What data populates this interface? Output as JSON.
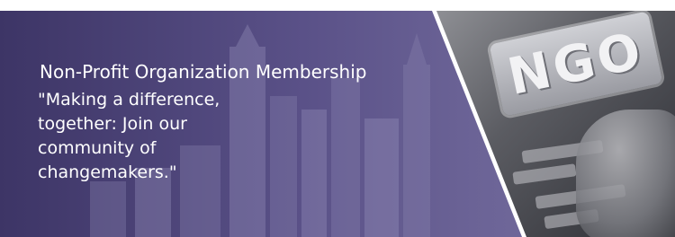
{
  "banner": {
    "title": "Non-Profit Organization Membership",
    "quote_lines": [
      "\"Making a difference,",
      "together: Join our",
      "community of",
      "changemakers.\""
    ],
    "key_text": "NGO"
  },
  "colors": {
    "purple_dark": "#3d3566",
    "purple_light": "#7a72a2",
    "text": "#ffffff"
  }
}
